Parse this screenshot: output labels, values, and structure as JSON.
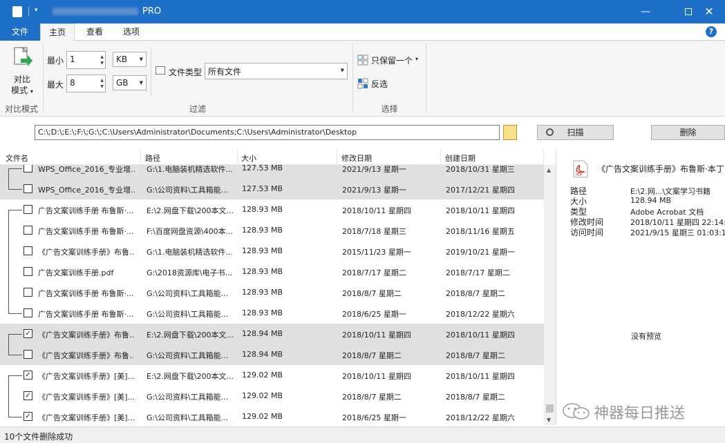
{
  "titlebar": {
    "title_suffix": "PRO"
  },
  "tabs": [
    "文件",
    "主页",
    "查看",
    "选项"
  ],
  "ribbon": {
    "compare_mode_label": "对比\n模式",
    "compare_mode_line1": "对比",
    "compare_mode_line2": "模式",
    "compare_group": "对比模式",
    "min_label": "最小",
    "min_value": "1",
    "min_unit": "KB",
    "max_label": "最大",
    "max_value": "8",
    "max_unit": "GB",
    "filetype_label": "文件类型",
    "filetype_value": "所有文件",
    "filter_group": "过滤",
    "keep_one": "只保留一个",
    "invert": "反选",
    "select_group": "选择"
  },
  "path": {
    "value": "C:\\;D:\\;E:\\;F:\\;G:\\;C:\\Users\\Administrator\\Documents;C:\\Users\\Administrator\\Desktop",
    "scan_label": "扫描",
    "delete_label": "删除"
  },
  "table": {
    "headers": [
      "文件名",
      "路径",
      "大小",
      "修改日期",
      "创建日期"
    ],
    "rows": [
      {
        "checked": false,
        "name": "WPS_Office_2016_专业增...",
        "path": "G:\\1.电脑装机精选软件...",
        "size": "127.53 MB",
        "modified": "2021/9/13 星期一",
        "created": "2018/10/31 星期三"
      },
      {
        "checked": false,
        "name": "WPS_Office_2016_专业增...",
        "path": "G:\\公司资料\\工具箱能...",
        "size": "127.53 MB",
        "modified": "2021/9/13 星期一",
        "created": "2017/12/21 星期四"
      },
      {
        "checked": false,
        "name": "广告文案训练手册 布鲁斯·...",
        "path": "E:\\2.网盘下载\\200本文...",
        "size": "128.93 MB",
        "modified": "2018/10/11 星期四",
        "created": "2018/10/11 星期四"
      },
      {
        "checked": false,
        "name": "广告文案训练手册 布鲁斯·...",
        "path": "F:\\百度网盘资源\\400本...",
        "size": "128.93 MB",
        "modified": "2018/7/18 星期三",
        "created": "2018/11/16 星期五"
      },
      {
        "checked": false,
        "name": "《广告文案训练手册》布鲁...",
        "path": "G:\\1.电脑装机精选软件...",
        "size": "128.93 MB",
        "modified": "2015/11/23 星期一",
        "created": "2019/10/21 星期一"
      },
      {
        "checked": false,
        "name": "广告文案训练手册.pdf",
        "path": "G:\\2018资源库\\电子书...",
        "size": "128.93 MB",
        "modified": "2018/7/17 星期二",
        "created": "2018/7/17 星期二"
      },
      {
        "checked": false,
        "name": "广告文案训练手册 布鲁斯·...",
        "path": "G:\\公司资料\\工具箱能...",
        "size": "128.93 MB",
        "modified": "2018/8/7 星期二",
        "created": "2018/8/7 星期二"
      },
      {
        "checked": false,
        "name": "广告文案训练手册 布鲁斯·...",
        "path": "G:\\公司资料\\工具箱能...",
        "size": "128.93 MB",
        "modified": "2018/6/25 星期一",
        "created": "2018/12/22 星期六"
      },
      {
        "checked": true,
        "name": "《广告文案训练手册》布鲁...",
        "path": "E:\\2.网盘下载\\200本文...",
        "size": "128.94 MB",
        "modified": "2018/10/11 星期四",
        "created": "2018/10/11 星期四"
      },
      {
        "checked": false,
        "name": "《广告文案训练手册》布鲁...",
        "path": "G:\\公司资料\\工具箱能...",
        "size": "128.94 MB",
        "modified": "2018/8/7 星期二",
        "created": "2018/8/7 星期二"
      },
      {
        "checked": true,
        "name": "《广告文案训练手册》[美]...",
        "path": "E:\\2.网盘下载\\200本文...",
        "size": "129.02 MB",
        "modified": "2018/10/11 星期四",
        "created": "2018/10/11 星期四"
      },
      {
        "checked": true,
        "name": "《广告文案训练手册》[美]...",
        "path": "G:\\公司资料\\工具箱能...",
        "size": "129.02 MB",
        "modified": "2018/8/7 星期二",
        "created": "2018/8/7 星期二"
      },
      {
        "checked": true,
        "name": "《广告文案训练手册》[美]...",
        "path": "G:\\公司资料\\工具箱能...",
        "size": "129.02 MB",
        "modified": "2018/6/25 星期一",
        "created": "2018/12/22 星期六"
      }
    ]
  },
  "detail": {
    "title": "《广告文案训练手册》布鲁斯·本丁",
    "fields": [
      {
        "k": "路径",
        "v": "E:\\2.网...\\文案学习书籍"
      },
      {
        "k": "大小",
        "v": "128.94 MB"
      },
      {
        "k": "类型",
        "v": "Adobe Acrobat 文档"
      },
      {
        "k": "修改时间",
        "v": "2018/10/11 星期四 22:14:"
      },
      {
        "k": "访问时间",
        "v": "2021/9/15 星期三 01:03:1"
      }
    ],
    "no_preview": "没有预览"
  },
  "watermark": "神器每日推送",
  "status": "10个文件删除成功",
  "colors": {
    "titlebar": "#1e6fc8",
    "group_row": "#e0e0e0",
    "pdf_red": "#d0332b"
  }
}
